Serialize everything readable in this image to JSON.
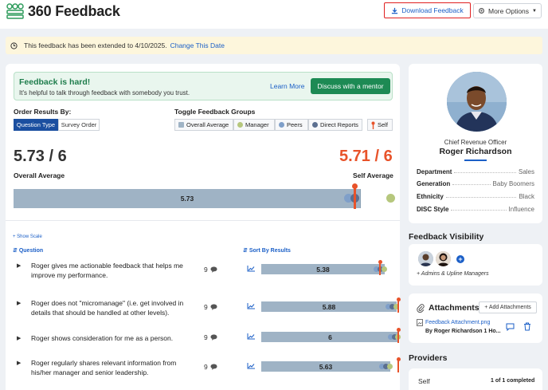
{
  "app": {
    "title": "360 Feedback"
  },
  "header": {
    "download_label": "Download Feedback",
    "more_label": "More Options"
  },
  "banner": {
    "text": "This feedback has been extended to 4/10/2025.",
    "link": "Change This Date"
  },
  "help": {
    "title": "Feedback is hard!",
    "subtitle": "It's helpful to talk through feedback with somebody you trust.",
    "learn_more": "Learn More",
    "discuss": "Discuss with a mentor"
  },
  "order": {
    "label": "Order Results By:",
    "options": [
      "Question Type",
      "Survey Order"
    ],
    "selected": "Question Type"
  },
  "toggle": {
    "label": "Toggle Feedback Groups",
    "groups": [
      {
        "label": "Overall Average",
        "color": "#9fb3c5"
      },
      {
        "label": "Manager",
        "color": "#b6c77d"
      },
      {
        "label": "Peers",
        "color": "#7f9fc9"
      },
      {
        "label": "Direct Reports",
        "color": "#5b6f90"
      },
      {
        "label": "Self",
        "color": "#e8532a"
      }
    ]
  },
  "summary": {
    "overall_score": "5.73 / 6",
    "overall_label": "Overall Average",
    "self_score": "5.71 / 6",
    "self_label": "Self Average",
    "bar_label": "5.73",
    "overall_value": 5.73,
    "self_value": 5.71,
    "scale_max": 6
  },
  "results": {
    "show_scale": "+ Show Scale",
    "question_head": "Question",
    "sort_head": "Sort By Results",
    "rows": [
      {
        "question": "Roger gives me actionable feedback that helps me improve my performance.",
        "count": "9",
        "value_label": "5.38",
        "value": 5.38,
        "self": 5.2
      },
      {
        "question": "Roger does not \"micromanage\" (i.e. get involved in details that should be handled at other levels).",
        "count": "9",
        "value_label": "5.88",
        "value": 5.88,
        "self": 6
      },
      {
        "question": "Roger shows consideration for me as a person.",
        "count": "9",
        "value_label": "6",
        "value": 6,
        "self": 6
      },
      {
        "question": "Roger regularly shares relevant information from his/her manager and senior leadership.",
        "count": "9",
        "value_label": "5.63",
        "value": 5.63,
        "self": 6
      }
    ]
  },
  "profile": {
    "title": "Chief Revenue Officer",
    "name": "Roger Richardson",
    "attributes": [
      {
        "key": "Department",
        "value": "Sales"
      },
      {
        "key": "Generation",
        "value": "Baby Boomers"
      },
      {
        "key": "Ethnicity",
        "value": "Black"
      },
      {
        "key": "DISC Style",
        "value": "Influence"
      }
    ]
  },
  "visibility": {
    "title": "Feedback Visibility",
    "note": "+ Admins & Upline Managers"
  },
  "attachments": {
    "title": "Attachments",
    "add_label": "+ Add Attachments",
    "file_name": "Feedback Attachment.png",
    "by": "By Roger Richardson 1 Ho..."
  },
  "providers": {
    "title": "Providers",
    "self_label": "Self",
    "self_count": "1 of 1 completed"
  }
}
